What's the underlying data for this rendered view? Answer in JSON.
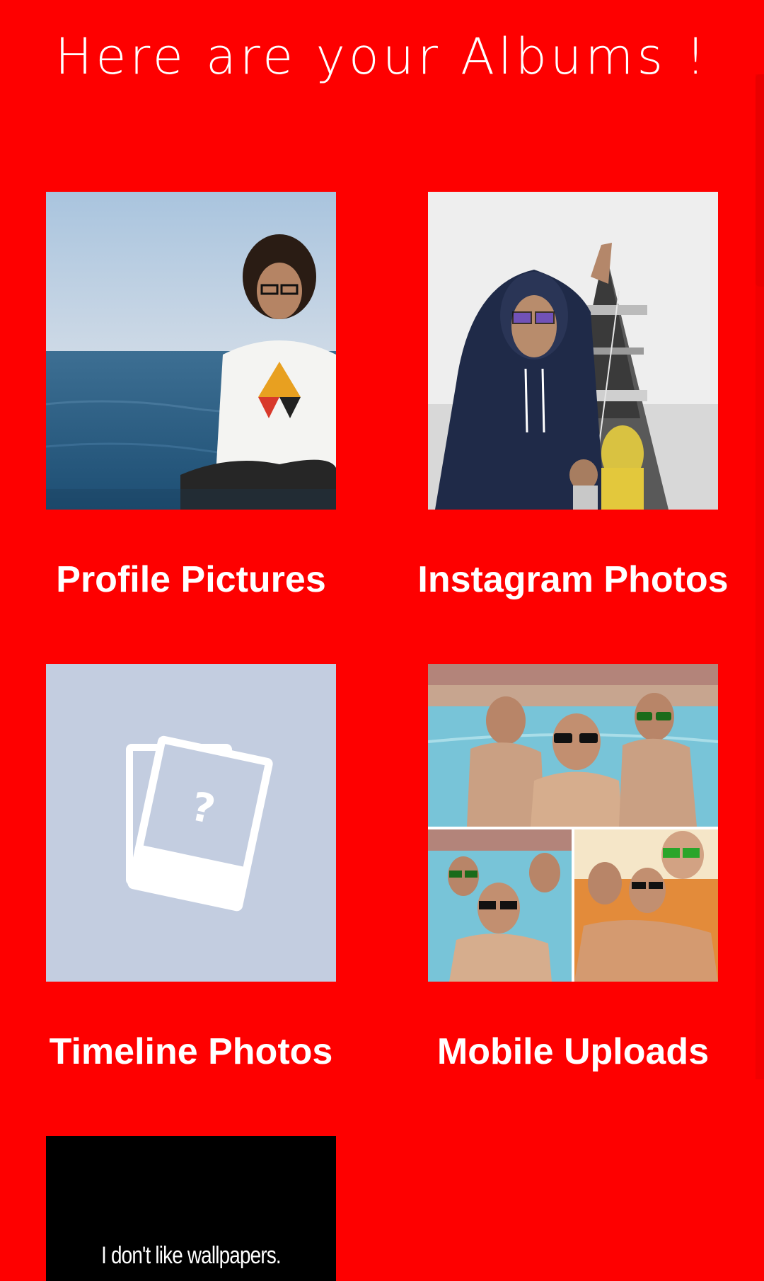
{
  "header": {
    "title": "Here are your Albums !"
  },
  "albums": [
    {
      "label": "Profile Pictures"
    },
    {
      "label": "Instagram Photos"
    },
    {
      "label": "Timeline Photos"
    },
    {
      "label": "Mobile Uploads"
    },
    {
      "label": "",
      "thumb_text": "I don't like wallpapers."
    }
  ],
  "colors": {
    "background": "#fe0000",
    "text": "#ffffff",
    "placeholder": "#c3cde0"
  },
  "icons": {
    "timeline_placeholder": "photo-placeholder-icon"
  }
}
